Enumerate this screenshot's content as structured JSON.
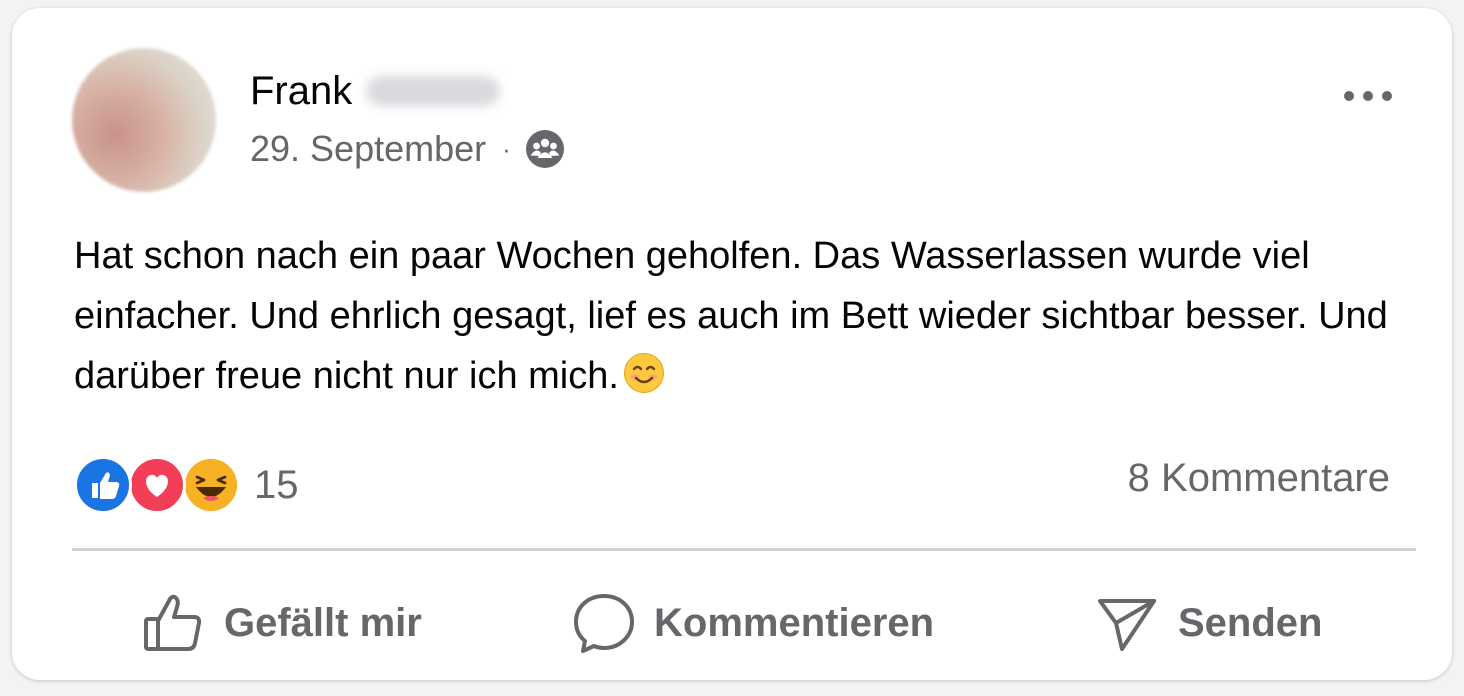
{
  "post": {
    "author_first_name": "Frank",
    "date": "29. September",
    "separator": "·",
    "audience_icon": "group-audience-icon",
    "more_icon": "more-horizontal-icon",
    "text": "Hat schon nach ein paar Wochen geholfen. Das Wasserlassen wurde viel einfacher. Und ehrlich gesagt, lief es auch im Bett wieder sichtbar besser. Und darüber freue nicht nur ich mich.",
    "text_emoji": "smiling-face-icon"
  },
  "reactions": {
    "icons": [
      "like-reaction-icon",
      "love-reaction-icon",
      "haha-reaction-icon"
    ],
    "count": "15",
    "comments_label": "8 Kommentare"
  },
  "actions": {
    "like_label": "Gefällt mir",
    "comment_label": "Kommentieren",
    "send_label": "Senden"
  },
  "colors": {
    "like_blue": "#1b74e4",
    "love_red": "#f33e58",
    "haha_yellow": "#f7b125",
    "secondary_text": "#65676b",
    "primary_text": "#050505"
  }
}
